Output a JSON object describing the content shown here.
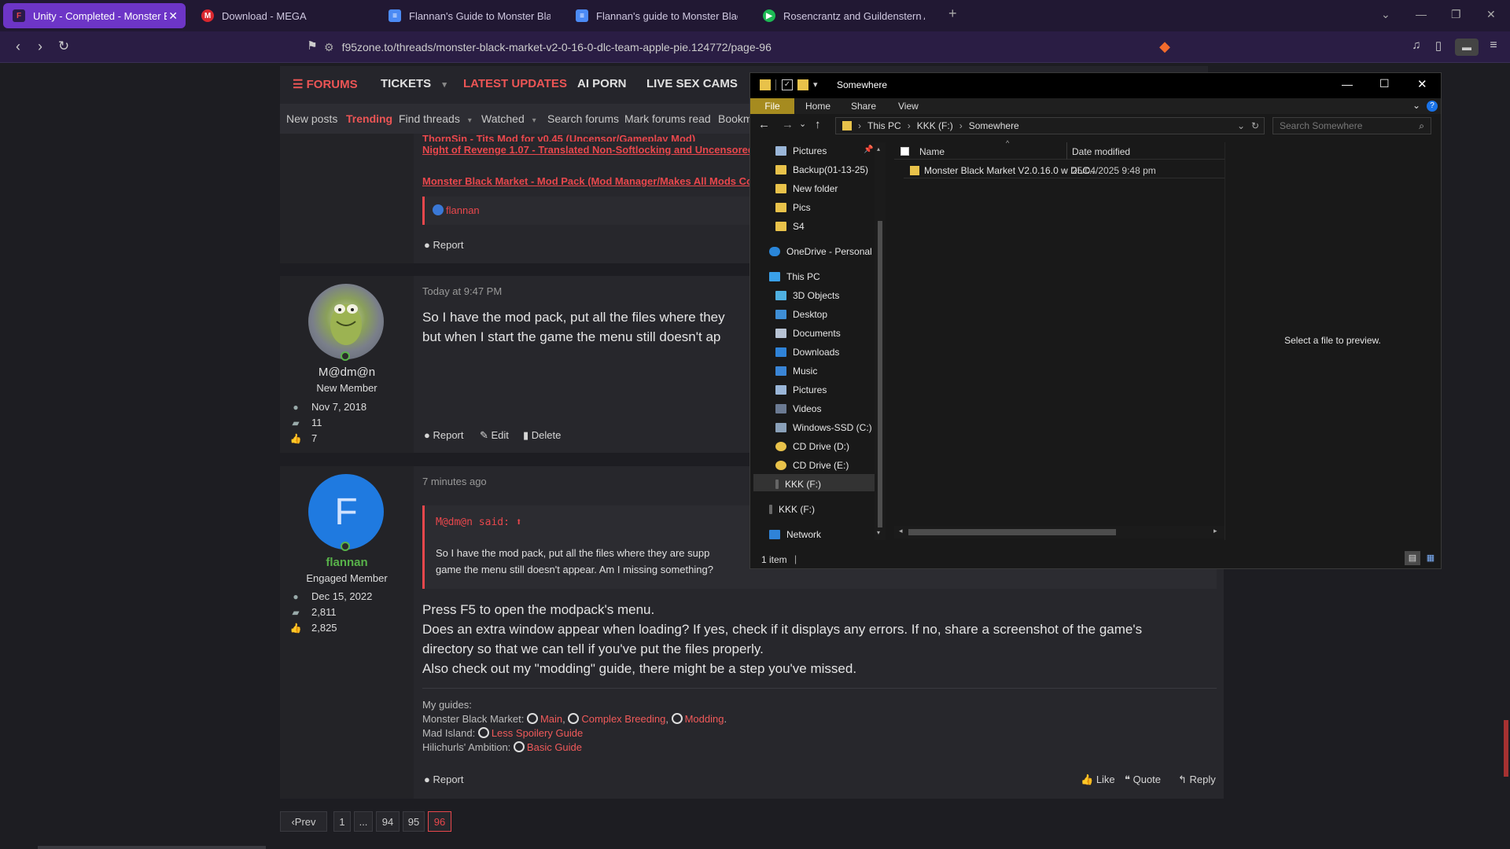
{
  "browser": {
    "tabs": [
      {
        "label": "Unity - Completed - Monster B",
        "color": "#6d35c7"
      },
      {
        "label": "Download - MEGA",
        "color": "#d9272e"
      },
      {
        "label": "Flannan's Guide to Monster Black M",
        "color": "#4c8bf5"
      },
      {
        "label": "Flannan's guide to Monster Black M",
        "color": "#4c8bf5"
      },
      {
        "label": "Rosencrantz and Guildenstern Are D",
        "color": "#1db954"
      }
    ],
    "url": "f95zone.to/threads/monster-black-market-v2-0-16-0-dlc-team-apple-pie.124772/page-96"
  },
  "forum_nav": {
    "items": [
      "FORUMS",
      "TICKETS",
      "LATEST UPDATES",
      "AI PORN",
      "LIVE SEX CAMS"
    ],
    "sub_items": [
      "New posts",
      "Trending",
      "Find threads",
      "Watched",
      "Search forums",
      "Mark forums read",
      "Bookm"
    ]
  },
  "post1": {
    "links": [
      "ThornSin - Tits Mod for v0.45 (Uncensor/Gameplay Mod)",
      "Night of Revenge 1.07 - Translated Non-Softlocking and Uncensored",
      "Monster Black Market - Mod Pack (Mod Manager/Makes All Mods Co"
    ],
    "user": "flannan",
    "report": "Report"
  },
  "post2": {
    "username": "M@dm@n",
    "role": "New Member",
    "joined": "Nov 7, 2018",
    "messages": "11",
    "reactions": "7",
    "date": "Today at 9:47 PM",
    "line1": "So I have the mod pack, put all the files where they",
    "line2": "but when I start the game the menu still doesn't ap",
    "report": "Report",
    "edit": "Edit",
    "delete": "Delete"
  },
  "post3": {
    "avatar_letter": "F",
    "username": "flannan",
    "role": "Engaged Member",
    "joined": "Dec 15, 2022",
    "messages": "2,811",
    "reactions": "2,825",
    "date": "7 minutes ago",
    "quote_author": "M@dm@n said:",
    "quote_line1": "So I have the mod pack, put all the files where they are supp",
    "quote_line2": "game the menu still doesn't appear. Am I missing something?",
    "body": [
      "Press F5 to open the modpack's menu.",
      "Does an extra window appear when loading? If yes, check if it displays any errors. If no, share a screenshot of the game's",
      "directory so that we can tell if you've put the files properly.",
      "Also check out my \"modding\" guide, there might be a step you've missed."
    ],
    "sig_title": "My guides:",
    "sig_mbm": "Monster Black Market:",
    "sig_mbm_links": [
      "Main",
      "Complex Breeding",
      "Modding"
    ],
    "sig_mad": "Mad Island:",
    "sig_mad_link": "Less Spoilery Guide",
    "sig_hil": "Hilichurls' Ambition:",
    "sig_hil_link": "Basic Guide",
    "report": "Report",
    "like": "Like",
    "quote": "Quote",
    "reply": "Reply"
  },
  "pagination": [
    "Prev",
    "1",
    "...",
    "94",
    "95",
    "96"
  ],
  "explorer": {
    "title": "Somewhere",
    "ribbon": [
      "File",
      "Home",
      "Share",
      "View"
    ],
    "path": [
      "This PC",
      "KKK (F:)",
      "Somewhere"
    ],
    "search_placeholder": "Search Somewhere",
    "nav_quick": [
      "Pictures",
      "Backup(01-13-25)",
      "New folder",
      "Pics",
      "S4"
    ],
    "onedrive": "OneDrive - Personal",
    "thispc": "This PC",
    "thispc_items": [
      "3D Objects",
      "Desktop",
      "Documents",
      "Downloads",
      "Music",
      "Pictures",
      "Videos",
      "Windows-SSD (C:)",
      "CD Drive (D:)",
      "CD Drive (E:)",
      "KKK (F:)"
    ],
    "kkk": "KKK (F:)",
    "network": "Network",
    "col_name": "Name",
    "col_date": "Date modified",
    "file_name": "Monster Black Market V2.0.16.0 w DLC...",
    "file_date": "25/04/2025 9:48 pm",
    "preview": "Select a file to preview.",
    "status": "1 item"
  }
}
